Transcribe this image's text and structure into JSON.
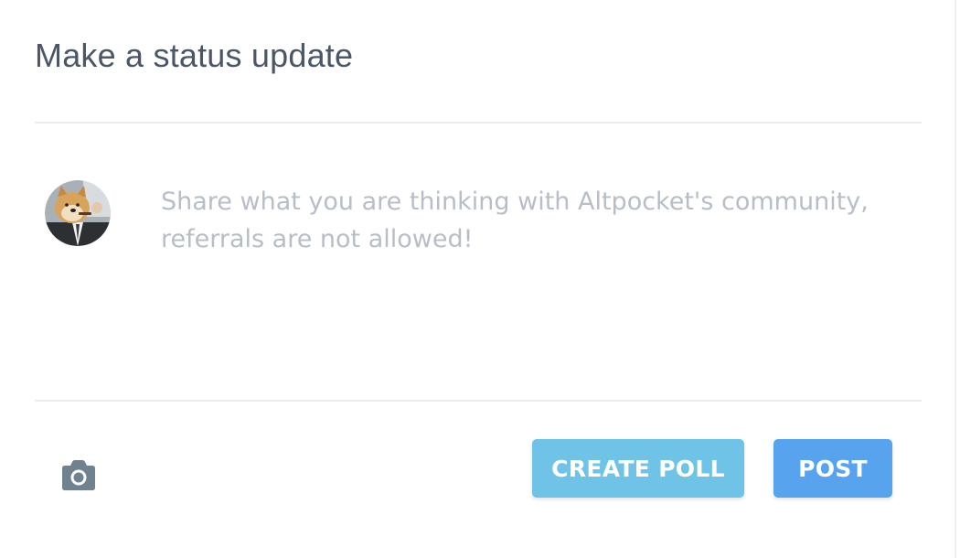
{
  "header": {
    "title": "Make a status update"
  },
  "composer": {
    "placeholder": "Share what you are thinking with Altpocket's community, referrals are not allowed!",
    "value": ""
  },
  "actions": {
    "photo_icon": "camera-icon",
    "create_poll_label": "CREATE POLL",
    "post_label": "POST"
  },
  "colors": {
    "title": "#4b5666",
    "placeholder": "#b7bec7",
    "create_poll_bg": "#6ec3e6",
    "post_bg": "#58a3ee",
    "camera_icon": "#6e8290",
    "divider": "#eaedf0"
  }
}
